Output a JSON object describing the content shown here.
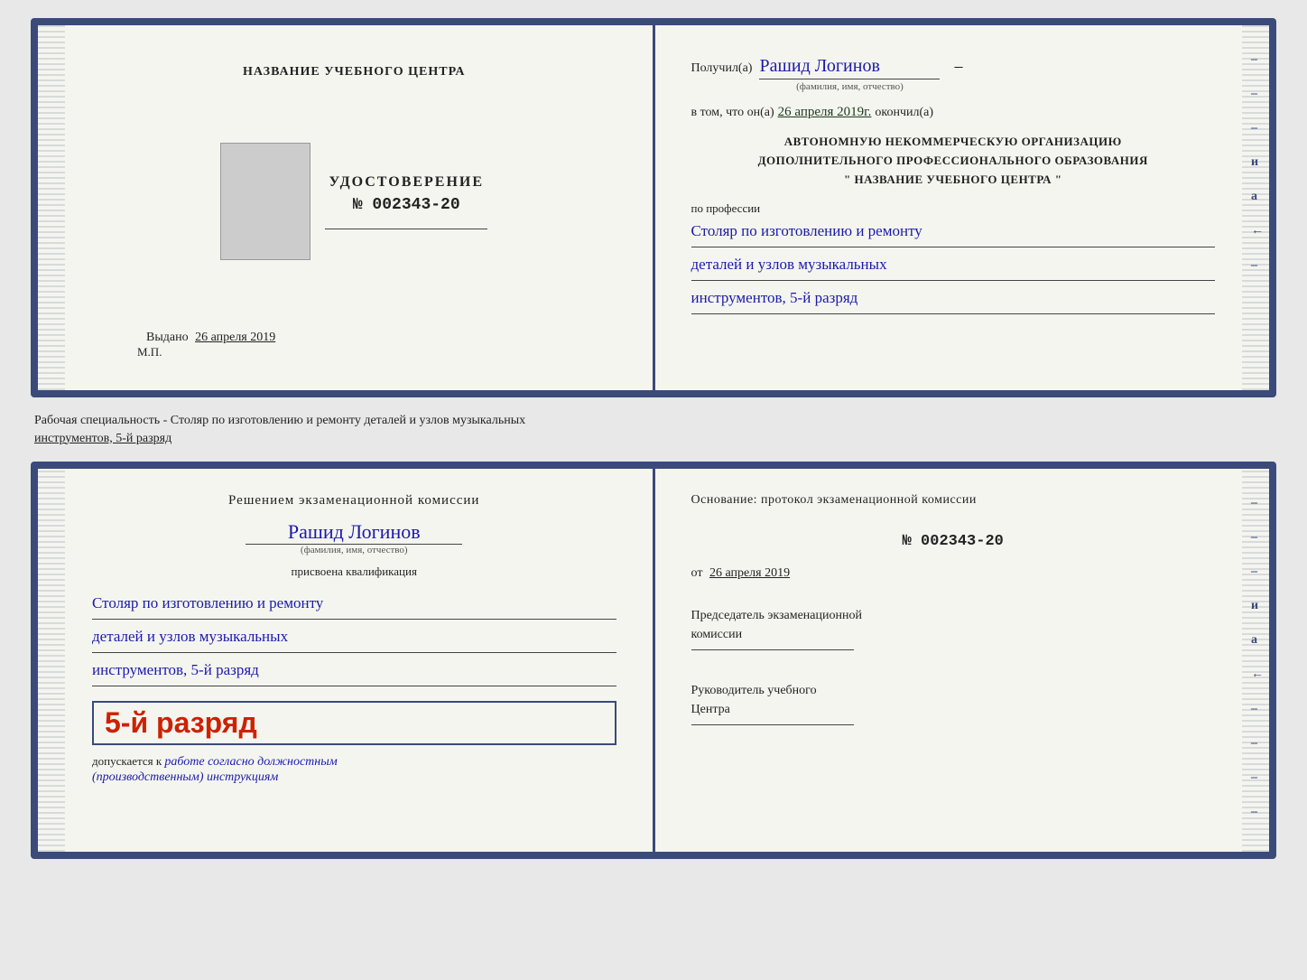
{
  "top_document": {
    "left": {
      "center_title": "НАЗВАНИЕ УЧЕБНОГО ЦЕНТРА",
      "cert_title": "УДОСТОВЕРЕНИЕ",
      "cert_number": "№ 002343-20",
      "issued_label": "Выдано",
      "issued_date": "26 апреля 2019",
      "stamp_label": "М.П."
    },
    "right": {
      "recipient_label": "Получил(а)",
      "recipient_name": "Рашид Логинов",
      "fio_label": "(фамилия, имя, отчество)",
      "date_intro": "в том, что он(а)",
      "date_value": "26 апреля 2019г.",
      "date_suffix": "окончил(а)",
      "org_line1": "АВТОНОМНУЮ НЕКОММЕРЧЕСКУЮ ОРГАНИЗАЦИЮ",
      "org_line2": "ДОПОЛНИТЕЛЬНОГО ПРОФЕССИОНАЛЬНОГО ОБРАЗОВАНИЯ",
      "org_line3": "\"  НАЗВАНИЕ УЧЕБНОГО ЦЕНТРА  \"",
      "profession_label": "по профессии",
      "profession_line1": "Столяр по изготовлению и ремонту",
      "profession_line2": "деталей и узлов музыкальных",
      "profession_line3": "инструментов, 5-й разряд"
    }
  },
  "specialty_label": {
    "text1": "Рабочая специальность - Столяр по изготовлению и ремонту деталей и узлов музыкальных",
    "text2_underlined": "инструментов, 5-й разряд"
  },
  "bottom_document": {
    "left": {
      "commission_title": "Решением экзаменационной комиссии",
      "person_name": "Рашид Логинов",
      "fio_label": "(фамилия, имя, отчество)",
      "assigned_label": "присвоена квалификация",
      "qual_line1": "Столяр по изготовлению и ремонту",
      "qual_line2": "деталей и узлов музыкальных",
      "qual_line3": "инструментов, 5-й разряд",
      "rank_text": "5-й разряд",
      "allowed_label": "допускается к",
      "allowed_value": "работе согласно должностным",
      "allowed_value2": "(производственным) инструкциям"
    },
    "right": {
      "basis_label": "Основание: протокол экзаменационной комиссии",
      "protocol_number": "№  002343-20",
      "date_prefix": "от",
      "date_value": "26 апреля 2019",
      "chairman_label": "Председатель экзаменационной\nкомиссии",
      "head_label": "Руководитель учебного\nЦентра"
    }
  },
  "edge_marks": [
    "–",
    "–",
    "–",
    "и",
    "а",
    "←",
    "–",
    "–",
    "–",
    "–"
  ]
}
